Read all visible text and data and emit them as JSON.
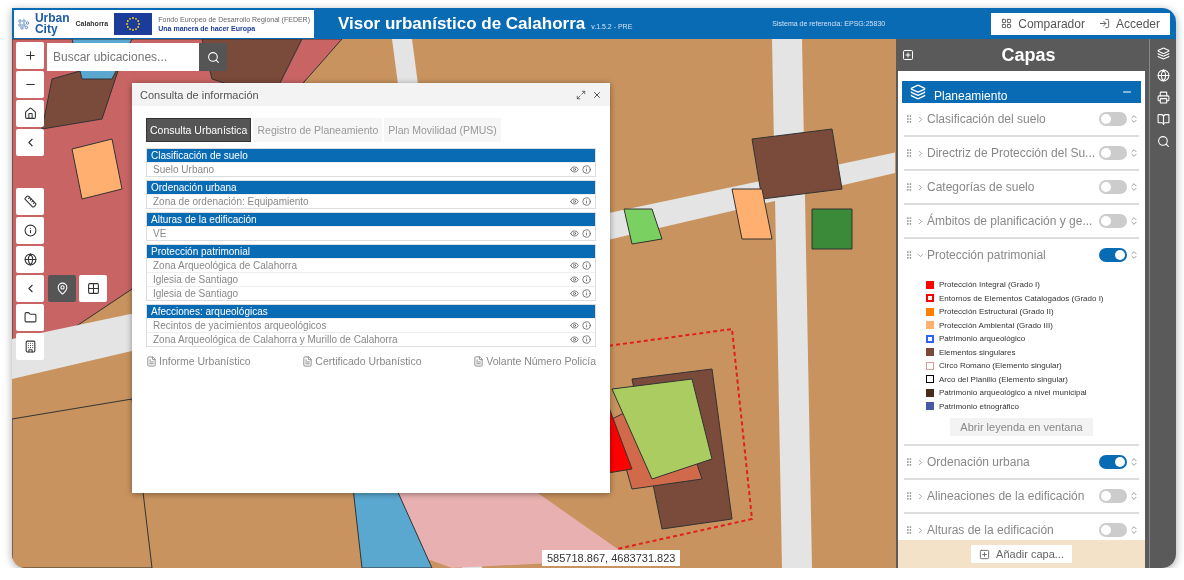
{
  "header": {
    "title": "Visor urbanístico de Calahorra",
    "version": "v.1.5.2 - PRE",
    "reference": "Sistema de referencia: EPSG:25830",
    "buttons": [
      {
        "kind": "compare",
        "label": "Comparador"
      },
      {
        "kind": "login",
        "label": "Acceder"
      }
    ]
  },
  "logo": {
    "line_1": "Urban",
    "line_2": "City",
    "partner": "Calahorra",
    "eu_text": "Fondo Europeo de Desarrollo Regional (FEDER)",
    "eu_motto": "Una manera de hacer Europa"
  },
  "search": {
    "placeholder": "Buscar ubicaciones..."
  },
  "map_tools": [
    {
      "kind": "zoom-in",
      "selected": false
    },
    {
      "kind": "zoom-out",
      "selected": false
    },
    {
      "kind": "home",
      "selected": false
    },
    {
      "kind": "back",
      "selected": false
    },
    {
      "kind": "measure",
      "selected": false
    },
    {
      "kind": "info",
      "selected": false
    },
    {
      "kind": "globe",
      "selected": false
    },
    {
      "kind": "back",
      "selected": false
    },
    {
      "kind": "folder",
      "selected": false
    },
    {
      "kind": "building",
      "selected": false
    }
  ],
  "pin_tools": [
    {
      "kind": "pin",
      "selected": true
    },
    {
      "kind": "grid",
      "selected": false
    }
  ],
  "dialog": {
    "title": "Consulta de información",
    "tabs": [
      {
        "label": "Consulta Urbanística",
        "selected": true
      },
      {
        "label": "Registro de Planeamiento",
        "selected": false
      },
      {
        "label": "Plan Movilidad (PMUS)",
        "selected": false
      }
    ],
    "sections": [
      {
        "title": "Clasificación de suelo",
        "rows": [
          "Suelo Urbano"
        ]
      },
      {
        "title": "Ordenación urbana",
        "rows": [
          "Zona de ordenación: Equipamiento"
        ]
      },
      {
        "title": "Alturas de la edificación",
        "rows": [
          "VE"
        ]
      },
      {
        "title": "Protección patrimonial",
        "rows": [
          "Zona Arqueológica de Calahorra",
          "Iglesia de Santiago",
          "Iglesia de Santiago"
        ]
      },
      {
        "title": "Afecciones: arqueológicas",
        "rows": [
          "Recintos de yacimientos arqueológicos",
          "Zona Arqueológica de Calahorra y Murillo de Calahorra"
        ]
      }
    ],
    "links": [
      "Informe Urbanístico",
      "Certificado Urbanístico",
      "Volante Número Policía"
    ]
  },
  "layers_panel": {
    "title": "Capas",
    "group": "Planeamiento",
    "layers": [
      {
        "label": "Clasificación del suelo",
        "on": false,
        "expanded": false
      },
      {
        "label": "Directriz de Protección del Su...",
        "on": false,
        "expanded": false
      },
      {
        "label": "Categorías de suelo",
        "on": false,
        "expanded": false
      },
      {
        "label": "Ámbitos de planificación y ge...",
        "on": false,
        "expanded": false
      },
      {
        "label": "Protección patrimonial",
        "on": true,
        "expanded": true,
        "legend": [
          {
            "label": "Protección Integral (Grado I)",
            "kind": "fill",
            "color": "#ff0000"
          },
          {
            "label": "Entornos de Elementos Catalogados (Grado I)",
            "kind": "dashed",
            "color": "#ff0000"
          },
          {
            "label": "Protección Estructural (Grado II)",
            "kind": "fill",
            "color": "#ff8000"
          },
          {
            "label": "Protección Ambiental (Grado III)",
            "kind": "fill",
            "color": "#ffb070"
          },
          {
            "label": "Patrimonio arqueológico",
            "kind": "dashed",
            "color": "#3060ff"
          },
          {
            "label": "Elementos singulares",
            "kind": "fill",
            "color": "#7a4a3a"
          },
          {
            "label": "Circo Romano (Elemento singular)",
            "kind": "outline",
            "color": "#d8a0a0"
          },
          {
            "label": "Arco del Planillo (Elemento singular)",
            "kind": "outline",
            "color": "#000000"
          },
          {
            "label": "Patrimonio arqueológico a nivel municipal",
            "kind": "fill",
            "color": "#4a2a1e"
          },
          {
            "label": "Patrimonio etnográfico",
            "kind": "fill",
            "color": "#4a5aa0"
          }
        ],
        "legend_button": "Abrir leyenda en ventana"
      },
      {
        "label": "Ordenación urbana",
        "on": true,
        "expanded": false
      },
      {
        "label": "Alineaciones de la edificación",
        "on": false,
        "expanded": false
      },
      {
        "label": "Alturas de la edificación",
        "on": false,
        "expanded": false
      }
    ],
    "add_layer": "Añadir capa..."
  },
  "coordinates": "585718.867, 4683731.823"
}
